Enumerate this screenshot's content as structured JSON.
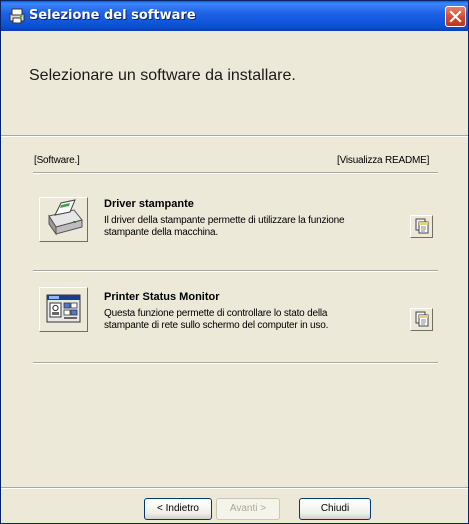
{
  "window": {
    "title": "Selezione del software",
    "close_icon": "close-icon"
  },
  "header": {
    "heading": "Selezionare un software da installare."
  },
  "list": {
    "left_label": "[Software.]",
    "right_label": "[Visualizza README]",
    "items": [
      {
        "title": "Driver stampante",
        "description": "Il driver della stampante permette di utilizzare la funzione\nstampante della macchina.",
        "icon": "printer-icon",
        "readme_icon": "document-icon"
      },
      {
        "title": "Printer Status Monitor",
        "description": "Questa funzione permette di controllare lo stato della\nstampante di rete sullo schermo del computer in uso.",
        "icon": "status-monitor-icon",
        "readme_icon": "document-icon"
      }
    ]
  },
  "footer": {
    "back_label": "< Indietro",
    "next_label": "Avanti >",
    "close_label": "Chiudi"
  },
  "colors": {
    "titlebar": "#0B4FD8",
    "face": "#ECE9D8",
    "close": "#D1452B"
  }
}
